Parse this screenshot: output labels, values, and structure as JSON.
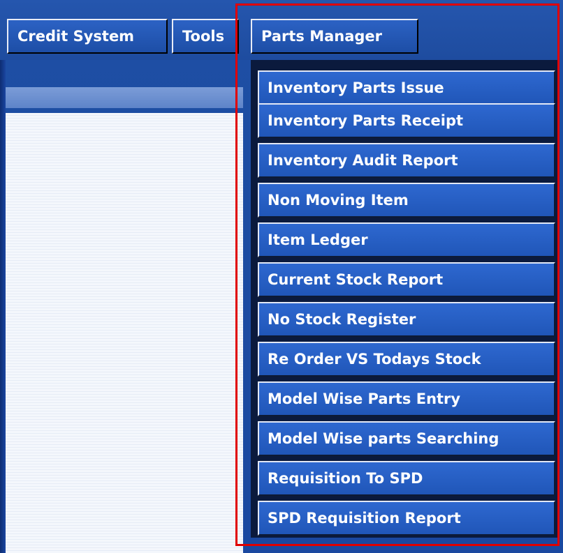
{
  "menubar": {
    "items": [
      {
        "label": "Credit System"
      },
      {
        "label": "Tools"
      },
      {
        "label": "Parts Manager"
      }
    ]
  },
  "dropdown": {
    "items": [
      {
        "label": "Inventory Parts Issue"
      },
      {
        "label": "Inventory Parts Receipt"
      },
      {
        "label": "Inventory Audit Report"
      },
      {
        "label": "Non Moving Item"
      },
      {
        "label": "Item Ledger"
      },
      {
        "label": "Current Stock Report"
      },
      {
        "label": "No Stock Register"
      },
      {
        "label": "Re Order VS Todays Stock"
      },
      {
        "label": "Model Wise Parts Entry"
      },
      {
        "label": "Model Wise parts Searching"
      },
      {
        "label": "Requisition To SPD"
      },
      {
        "label": "SPD Requisition Report"
      }
    ]
  },
  "colors": {
    "background": "#1e4c9e",
    "menu_button": "#2c62c4",
    "dropdown_item": "#2e68d0",
    "highlight": "#e00000",
    "text": "#ffffff"
  }
}
